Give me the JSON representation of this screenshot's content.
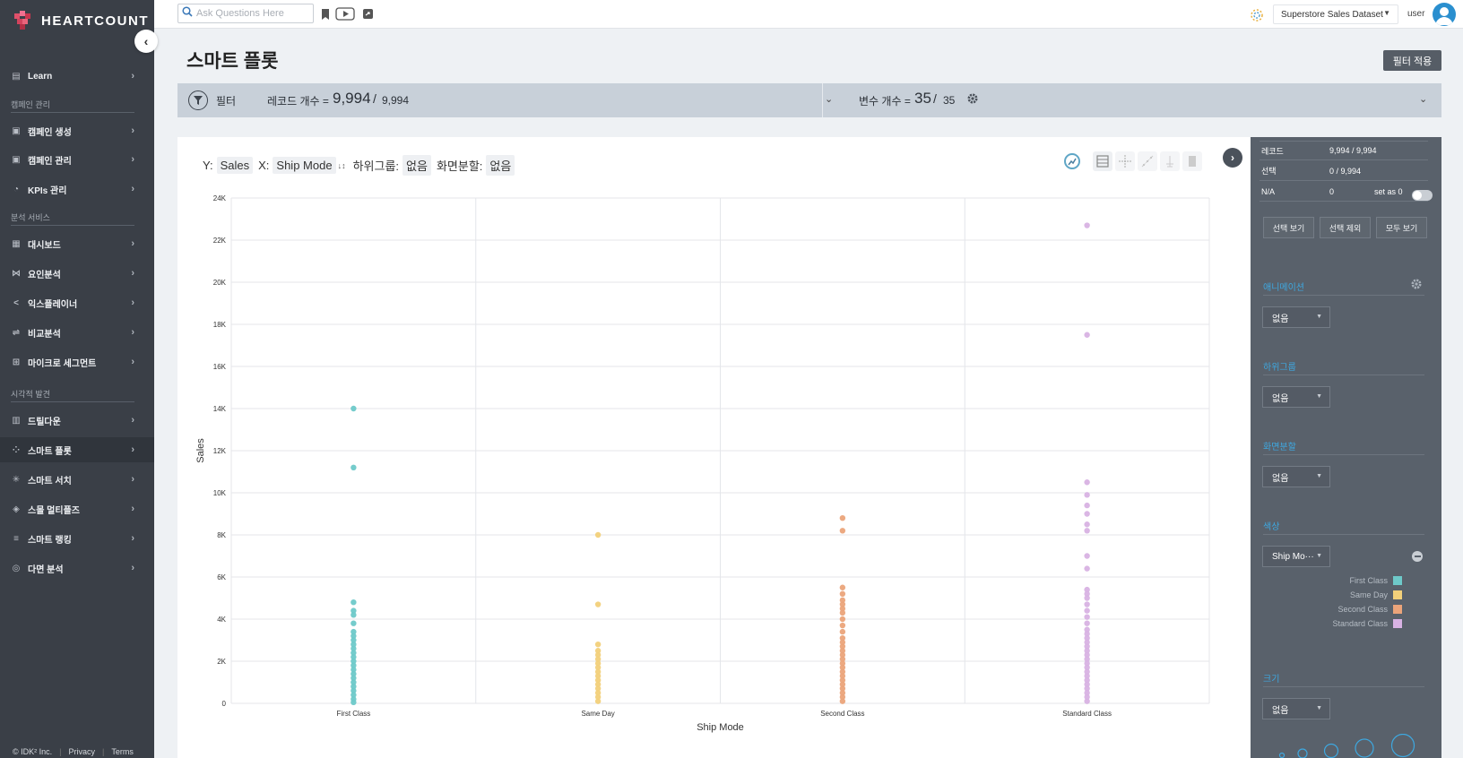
{
  "app": {
    "brand": "HEARTCOUNT"
  },
  "sidebar": {
    "items": [
      {
        "label": "Learn"
      },
      {
        "label": "캠페인 생성"
      },
      {
        "label": "캠페인 관리"
      },
      {
        "label": "KPIs 관리"
      },
      {
        "label": "대시보드"
      },
      {
        "label": "요인분석"
      },
      {
        "label": "익스플레이너"
      },
      {
        "label": "비교분석"
      },
      {
        "label": "마이크로 세그먼트"
      },
      {
        "label": "드릴다운"
      },
      {
        "label": "스마트 플롯"
      },
      {
        "label": "스마트 서치"
      },
      {
        "label": "스몰 멀티플즈"
      },
      {
        "label": "스마트 랭킹"
      },
      {
        "label": "다면 분석"
      }
    ],
    "sections": [
      "캠페인 관리",
      "분석 서비스",
      "시각적 발견"
    ],
    "footer": {
      "copyright": "© IDK² Inc.",
      "privacy": "Privacy",
      "terms": "Terms"
    }
  },
  "topbar": {
    "search_placeholder": "Ask Questions Here",
    "dataset": "Superstore Sales Dataset",
    "user": "user"
  },
  "main": {
    "title": "스마트 플롯",
    "apply_filter": "필터 적용",
    "filter": {
      "label": "필터",
      "record_label": "레코드 개수 =",
      "record_value": "9,994",
      "record_sep": "/",
      "record_total": "9,994",
      "var_label": "변수 개수 =",
      "var_value": "35",
      "var_sep": "/",
      "var_total": "35"
    },
    "axis": {
      "y_label": "Y:",
      "y_value": "Sales",
      "x_label": "X:",
      "x_value": "Ship Mode",
      "subgroup_label": "하위그룹:",
      "subgroup_value": "없음",
      "split_label": "화면분할:",
      "split_value": "없음"
    }
  },
  "panel": {
    "records": {
      "label": "레코드",
      "value": "9,994 / 9,994"
    },
    "selection": {
      "label": "선택",
      "value": "0 / 9,994"
    },
    "na": {
      "label": "N/A",
      "value": "0",
      "set_as_zero": "set as 0"
    },
    "buttons": {
      "view_selected": "선택 보기",
      "exclude_selected": "선택 제외",
      "view_all": "모두 보기"
    },
    "annotation": {
      "title": "애니메이션",
      "value": "없음"
    },
    "subgroup": {
      "title": "하위그룹",
      "value": "없음"
    },
    "split": {
      "title": "화면분할",
      "value": "없음"
    },
    "color": {
      "title": "색상",
      "value": "Ship Mo···"
    },
    "size": {
      "title": "크기",
      "value": "없음"
    },
    "legend": [
      {
        "name": "First Class",
        "color": "#6ec9c9"
      },
      {
        "name": "Same Day",
        "color": "#f2d07a"
      },
      {
        "name": "Second Class",
        "color": "#eba47a"
      },
      {
        "name": "Standard Class",
        "color": "#d8b2e3"
      }
    ]
  },
  "chart_data": {
    "type": "scatter",
    "xlabel": "Ship Mode",
    "ylabel": "Sales",
    "categories": [
      "First Class",
      "Same Day",
      "Second Class",
      "Standard Class"
    ],
    "ylim": [
      0,
      24000
    ],
    "yticks": [
      "0",
      "2K",
      "4K",
      "6K",
      "8K",
      "10K",
      "12K",
      "14K",
      "16K",
      "18K",
      "20K",
      "22K",
      "24K"
    ],
    "grid": true,
    "series": [
      {
        "name": "First Class",
        "color": "#6ec9c9",
        "values": [
          14000,
          11200,
          4800,
          4400,
          4200,
          3800,
          3400,
          3200,
          3000,
          2800,
          2600,
          2400,
          2200,
          2000,
          1800,
          1600,
          1400,
          1200,
          1000,
          800,
          600,
          400,
          200,
          50
        ]
      },
      {
        "name": "Same Day",
        "color": "#f2d07a",
        "values": [
          8000,
          4700,
          2800,
          2500,
          2300,
          2100,
          1900,
          1700,
          1500,
          1300,
          1100,
          900,
          700,
          500,
          300,
          100
        ]
      },
      {
        "name": "Second Class",
        "color": "#eba47a",
        "values": [
          8800,
          8200,
          5500,
          5200,
          4900,
          4700,
          4500,
          4300,
          4000,
          3700,
          3400,
          3100,
          2900,
          2700,
          2500,
          2300,
          2100,
          1900,
          1700,
          1500,
          1300,
          1100,
          900,
          700,
          500,
          300,
          100
        ]
      },
      {
        "name": "Standard Class",
        "color": "#d8b2e3",
        "values": [
          22700,
          17500,
          10500,
          9900,
          9400,
          9000,
          8500,
          8200,
          7000,
          6400,
          5400,
          5200,
          5000,
          4700,
          4400,
          4100,
          3800,
          3500,
          3300,
          3100,
          2900,
          2700,
          2500,
          2300,
          2100,
          1900,
          1700,
          1500,
          1300,
          1100,
          900,
          700,
          500,
          300,
          100
        ]
      }
    ]
  }
}
